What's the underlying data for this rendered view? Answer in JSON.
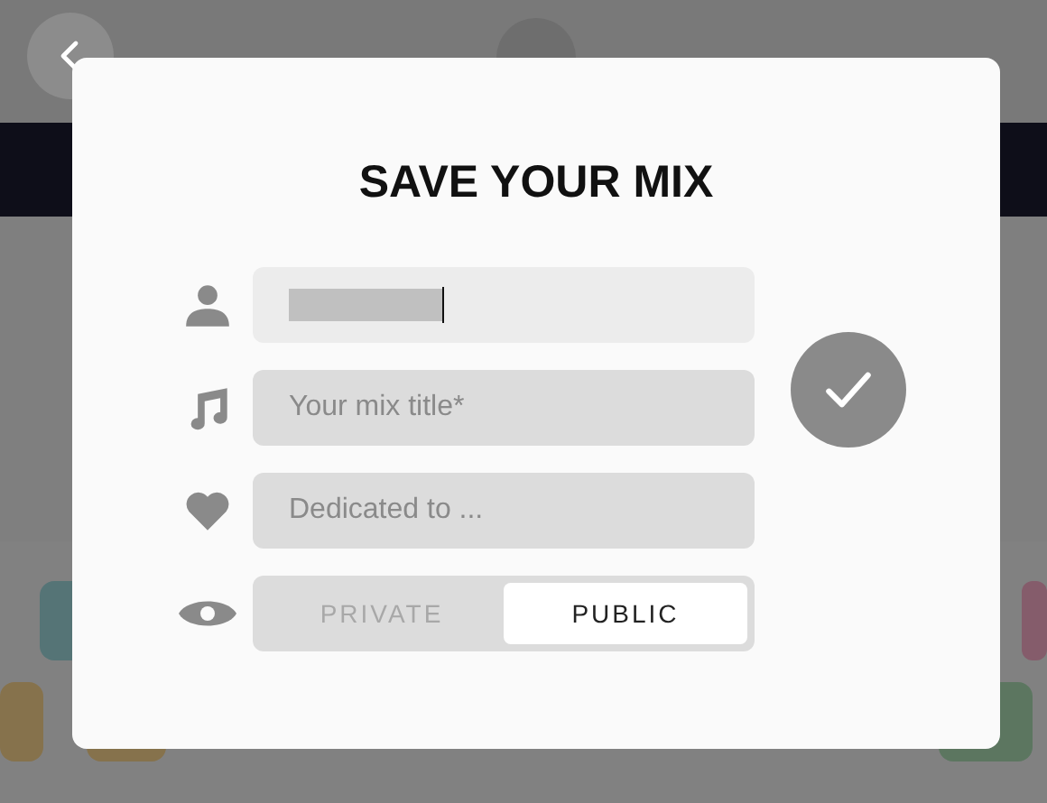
{
  "dialog": {
    "title": "SAVE YOUR MIX",
    "fields": [
      {
        "kind": "person",
        "focused": true
      },
      {
        "kind": "music",
        "placeholder": "Your mix title*",
        "focused": false
      },
      {
        "kind": "heart",
        "placeholder": "Dedicated to ...",
        "focused": false
      }
    ],
    "visibility": [
      {
        "label": "PRIVATE",
        "selected": false
      },
      {
        "label": "PUBLIC",
        "selected": true
      }
    ]
  }
}
